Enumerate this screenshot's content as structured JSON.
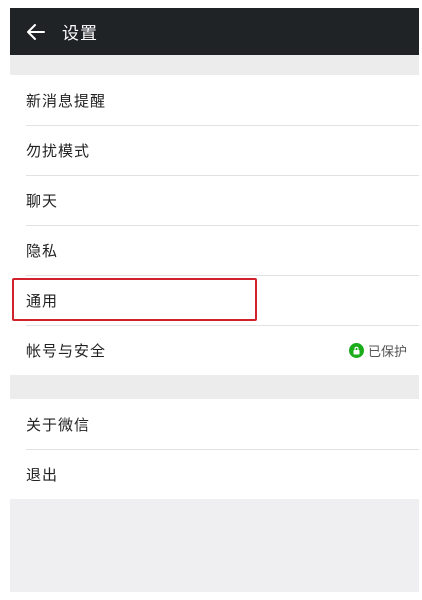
{
  "header": {
    "title": "设置"
  },
  "settings": {
    "group1": [
      {
        "label": "新消息提醒"
      },
      {
        "label": "勿扰模式"
      },
      {
        "label": "聊天"
      },
      {
        "label": "隐私"
      },
      {
        "label": "通用",
        "highlighted": true
      },
      {
        "label": "帐号与安全",
        "status": "已保护",
        "status_icon": "lock-icon",
        "status_color": "#1aad19"
      }
    ],
    "group2": [
      {
        "label": "关于微信"
      },
      {
        "label": "退出"
      }
    ]
  },
  "colors": {
    "titlebar": "#1f2326",
    "highlight_border": "#d0212c",
    "status_green": "#1aad19"
  }
}
